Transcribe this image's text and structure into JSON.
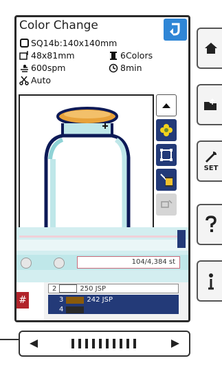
{
  "header": {
    "title": "Color Change"
  },
  "info": {
    "hoop": "SQ14b:140x140mm",
    "size": "48x81mm",
    "colors": "6Colors",
    "speed": "600spm",
    "time": "8min",
    "cut": "Auto"
  },
  "stitch_counter": "104/4,384 st",
  "threads": [
    {
      "number": "2",
      "code": "250 JSP",
      "color": "#ffffff"
    },
    {
      "number": "3",
      "code": "242 JSP",
      "color": "#8a5a0a"
    },
    {
      "number": "4",
      "code": "",
      "color": "#2a2a2a"
    }
  ],
  "left_tab": {
    "label": "#"
  },
  "right_rail": {
    "set_label": "SET"
  },
  "icons": {
    "back": "back-arrow-icon",
    "home": "home-icon",
    "file": "file-export-icon",
    "settings": "wrench-icon",
    "help": "question-mark-icon",
    "info": "info-icon"
  },
  "colors": {
    "accent": "#2f86d6",
    "tool_bg": "#233a78",
    "thread_gold": "#8a5a0a",
    "bottle_outline": "#0d1a57",
    "bottle_fill": "#bfe7e9"
  }
}
